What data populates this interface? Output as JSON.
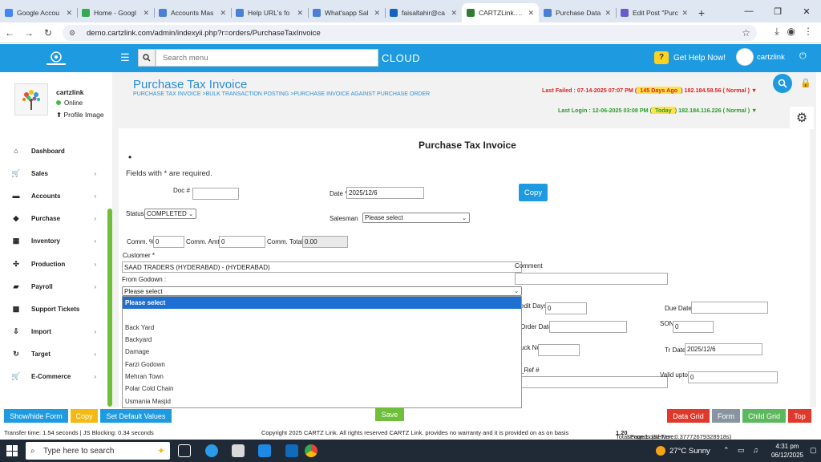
{
  "browser": {
    "tabs": [
      {
        "label": "Google Accou",
        "color": "#4285f4"
      },
      {
        "label": "Home - Googl",
        "color": "#34a853"
      },
      {
        "label": "Accounts Mas",
        "color": "#4a7fd6"
      },
      {
        "label": "Help URL's fo",
        "color": "#4a7fd6"
      },
      {
        "label": "What'sapp Sal",
        "color": "#4a7fd6"
      },
      {
        "label": "faisaltahir@ca",
        "color": "#1565c0"
      },
      {
        "label": "CARTZLink.com",
        "color": "#2e7d32",
        "active": true
      },
      {
        "label": "Purchase Data",
        "color": "#4a7fd6"
      },
      {
        "label": "Edit Post \"Purc",
        "color": "#6a5acd"
      }
    ],
    "url": "demo.cartzlink.com/admin/indexyii.php?r=orders/PurchaseTaxInvoice"
  },
  "header": {
    "search_placeholder": "Search menu",
    "cloud": "CLOUD",
    "help": "Get Help Now!",
    "username": "cartzlink"
  },
  "profile": {
    "name": "cartzlink",
    "status": "Online",
    "image_link": "Profile Image"
  },
  "menu": [
    {
      "label": "Dashboard",
      "icon": "home-icon",
      "glyph": "⌂",
      "arrow": false
    },
    {
      "label": "Sales",
      "icon": "cart-icon",
      "glyph": "🛒",
      "arrow": true
    },
    {
      "label": "Accounts",
      "icon": "bank-icon",
      "glyph": "▬",
      "arrow": true
    },
    {
      "label": "Purchase",
      "icon": "tag-icon",
      "glyph": "◆",
      "arrow": true
    },
    {
      "label": "Inventory",
      "icon": "grid-icon",
      "glyph": "▦",
      "arrow": true
    },
    {
      "label": "Production",
      "icon": "gears-icon",
      "glyph": "✣",
      "arrow": true
    },
    {
      "label": "Payroll",
      "icon": "dollar-icon",
      "glyph": "▰",
      "arrow": true
    },
    {
      "label": "Support Tickets",
      "icon": "ticket-icon",
      "glyph": "▩",
      "arrow": false
    },
    {
      "label": "Import",
      "icon": "import-icon",
      "glyph": "⇩",
      "arrow": true
    },
    {
      "label": "Target",
      "icon": "refresh-icon",
      "glyph": "↻",
      "arrow": true
    },
    {
      "label": "E-Commerce",
      "icon": "cart-icon",
      "glyph": "🛒",
      "arrow": true
    }
  ],
  "page": {
    "title": "Purchase Tax Invoice",
    "breadcrumb": "PURCHASE TAX INVOICE  >BULK TRANSACTION POSTING  >PURCHASE INVOICE AGAINST PURCHASE ORDER",
    "last_failed_prefix": "Last Failed : 07-14-2025 07:07 PM (",
    "last_failed_days": " 145 Days Ago ",
    "last_failed_suffix": ") 182.184.58.56 ( Normal ) ▼",
    "last_login_prefix": "Last Login : 12-06-2025 03:08 PM (",
    "last_login_days": " Today ",
    "last_login_suffix": ") 182.184.116.226 ( Normal ) ▼"
  },
  "form": {
    "title": "Purchase Tax Invoice",
    "required_note": "Fields with * are required.",
    "doc_label": "Doc # :",
    "doc_value": "",
    "date_label": "Date *",
    "date_value": "2025/12/6",
    "copy_label": "Copy",
    "status_label": "Status",
    "status_value": "COMPLETED",
    "salesman_label": "Salesman",
    "salesman_value": "Please select",
    "comm_pct_label": "Comm. %",
    "comm_pct_value": "0",
    "comm_amt_label": "Comm. Amt",
    "comm_amt_value": "0",
    "comm_total_label": "Comm. Total",
    "comm_total_value": "0.00",
    "customer_label": "Customer *",
    "customer_value": "SAAD TRADERS (HYDERABAD) - (HYDERABAD)",
    "comment_label": "Comment",
    "godown_label": "From Godown :",
    "godown_value": "Please select",
    "credit_days_label": "edit Days",
    "credit_days_value": "0",
    "due_date_label": "Due Date",
    "order_date_label": "Order Date",
    "son_label": "SON",
    "son_value": "0",
    "truck_label": "uck No",
    "tr_date_label": "Tr Date",
    "tr_date_value": "2025/12/6",
    "ref_label": "_Ref #",
    "valid_label": "Valid upto :",
    "valid_value": "0"
  },
  "godown_options": [
    "Please select",
    "",
    "Back Yard",
    "Backyard",
    "Damage",
    "Farzi Godown",
    "Mehran Town",
    "Polar Cold Chain",
    "Usmania Masjid"
  ],
  "buttons": {
    "show_hide": "Show/hide Form",
    "copy": "Copy",
    "set_default": "Set Default Values",
    "save": "Save",
    "data_grid": "Data Grid",
    "form": "Form",
    "child_grid": "Child Grid",
    "top": "Top"
  },
  "footer": {
    "transfer": "Transfer time: 1.54 seconds  |  JS Blocking: 0.34 seconds",
    "copyright": "Copyright 2025 CARTZ Link. All rights reserved CARTZ Link. provides no warranty and it is provided on as on basis",
    "load_prefix": "Total Page Load Time: ",
    "load_time": "1.20",
    "load_suffix": " seconds (Server: 0.37772679328918s)"
  },
  "taskbar": {
    "search": "Type here to search",
    "weather": "27°C  Sunny",
    "time": "4:31 pm",
    "date": "06/12/2025"
  }
}
